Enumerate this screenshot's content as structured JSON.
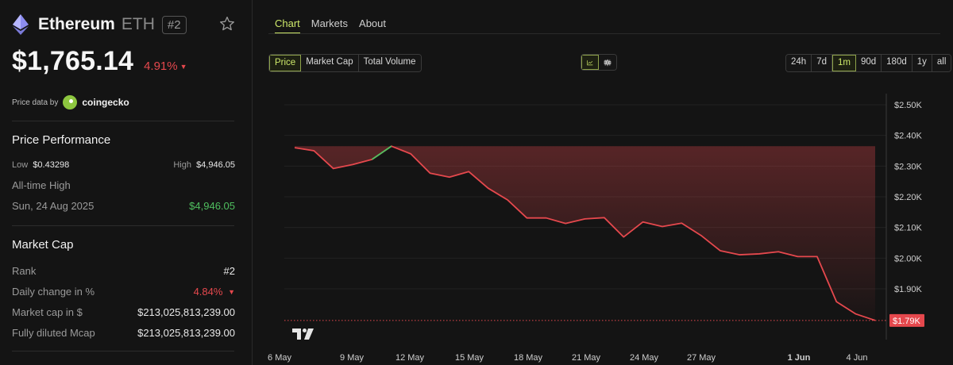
{
  "coin": {
    "name": "Ethereum",
    "symbol": "ETH",
    "rank_badge": "#2",
    "price": "$1,765.14",
    "change": "4.91%",
    "change_arrow": "▼"
  },
  "price_source": {
    "label": "Price data by",
    "provider": "coingecko"
  },
  "performance": {
    "title": "Price Performance",
    "low_label": "Low",
    "low_value": "$0.43298",
    "high_label": "High",
    "high_value": "$4,946.05",
    "ath_label": "All-time High",
    "ath_date": "Sun, 24 Aug 2025",
    "ath_value": "$4,946.05"
  },
  "market_cap": {
    "title": "Market Cap",
    "rank_label": "Rank",
    "rank_value": "#2",
    "daily_label": "Daily change in %",
    "daily_value": "4.84%",
    "daily_arrow": "▼",
    "mcap_label": "Market cap in $",
    "mcap_value": "$213,025,813,239.00",
    "fdv_label": "Fully diluted Mcap",
    "fdv_value": "$213,025,813,239.00"
  },
  "tabs": [
    "Chart",
    "Markets",
    "About"
  ],
  "metrics": [
    "Price",
    "Market Cap",
    "Total Volume"
  ],
  "ranges": [
    "24h",
    "7d",
    "1m",
    "90d",
    "180d",
    "1y",
    "all"
  ],
  "icons": {
    "line": "line-chart-icon",
    "candle": "candlestick-icon",
    "star": "star-icon",
    "coin": "ethereum-icon"
  },
  "colors": {
    "accent": "#cde86a",
    "down": "#e5484d",
    "up": "#4fbf5f"
  },
  "chart_data": {
    "type": "line",
    "y_ticks": [
      "$2.50K",
      "$2.40K",
      "$2.30K",
      "$2.20K",
      "$2.10K",
      "$2.00K",
      "$1.90K"
    ],
    "x_ticks": [
      "6 May",
      "9 May",
      "12 May",
      "15 May",
      "18 May",
      "21 May",
      "24 May",
      "27 May",
      "1 Jun",
      "4 Jun"
    ],
    "ylim": [
      1790,
      2500
    ],
    "current_label": "$1.79K",
    "x": [
      0,
      1,
      2,
      3,
      4,
      5,
      6,
      7,
      8,
      9,
      10,
      11,
      12,
      13,
      14,
      15,
      16,
      17,
      18,
      19,
      20,
      21,
      22,
      23,
      24,
      25,
      26,
      27,
      28,
      29,
      30,
      31
    ],
    "values": [
      2360,
      2350,
      2292,
      2305,
      2322,
      2365,
      2340,
      2277,
      2264,
      2282,
      2228,
      2190,
      2131,
      2131,
      2113,
      2128,
      2132,
      2069,
      2118,
      2103,
      2114,
      2074,
      2024,
      2011,
      2014,
      2021,
      2005,
      2005,
      1858,
      1818,
      1797
    ]
  }
}
